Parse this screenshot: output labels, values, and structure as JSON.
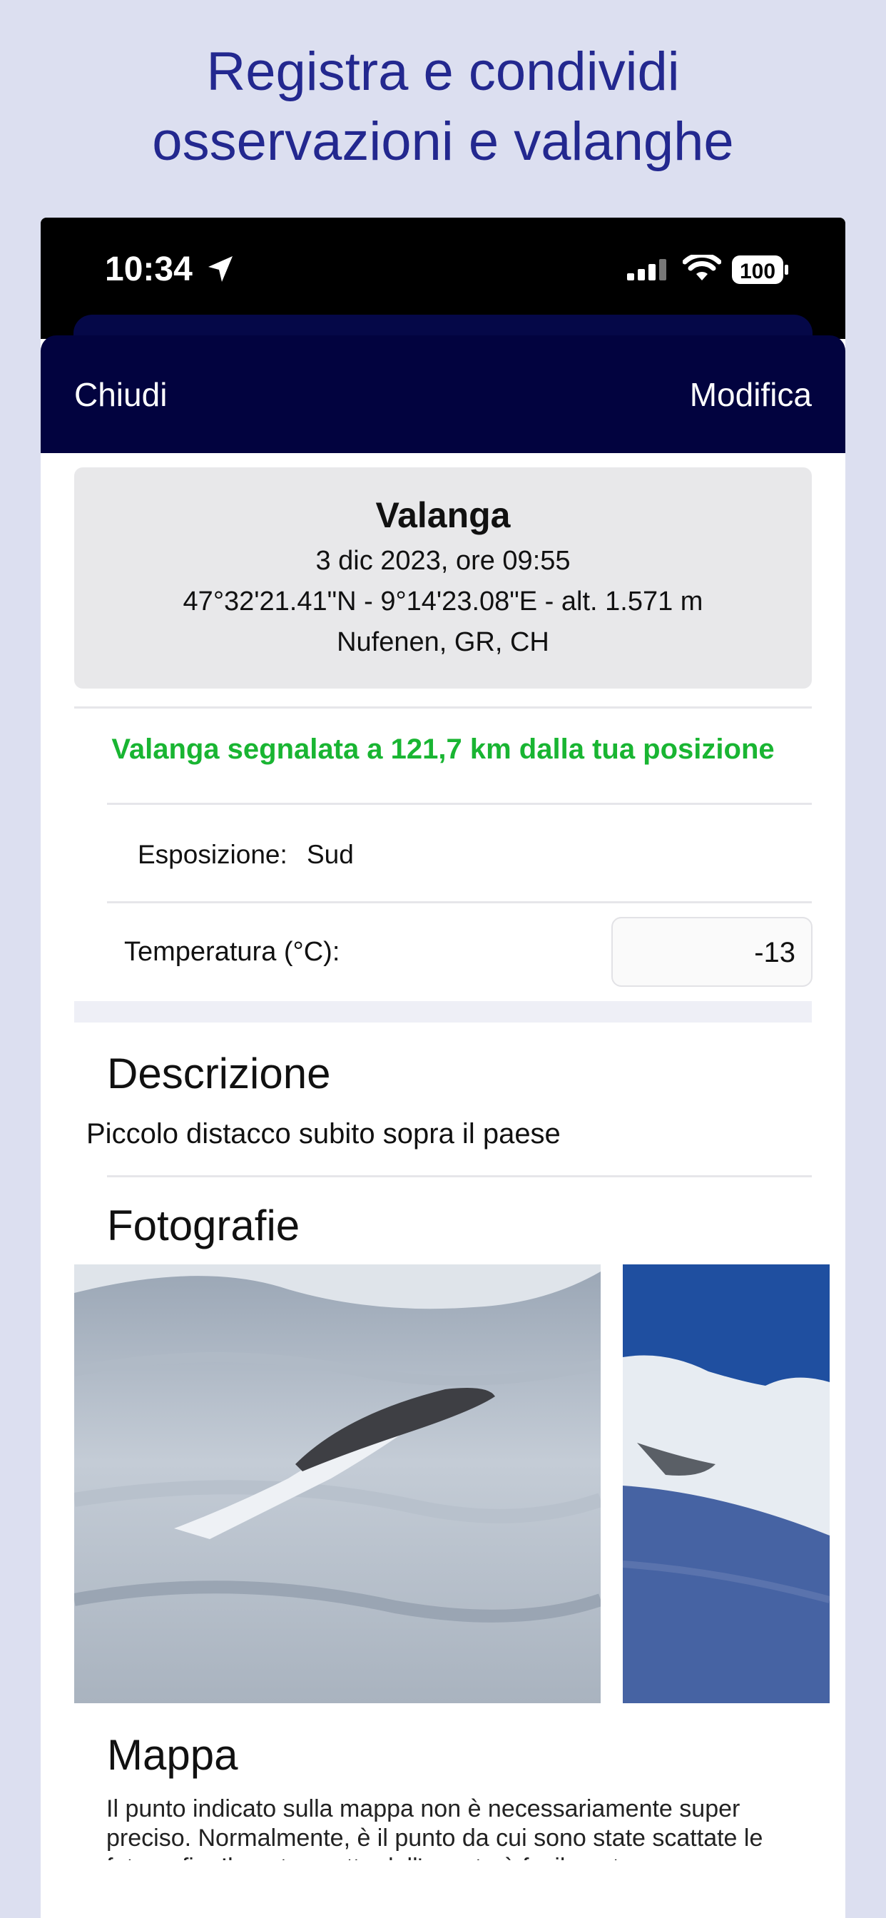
{
  "headline": {
    "line1": "Registra e condividi",
    "line2": "osservazioni e valanghe"
  },
  "status_bar": {
    "time": "10:34",
    "battery": "100",
    "icons": [
      "location-arrow-icon",
      "signal-icon",
      "wifi-icon",
      "battery-icon"
    ]
  },
  "nav": {
    "close_label": "Chiudi",
    "edit_label": "Modifica"
  },
  "summary": {
    "title": "Valanga",
    "date": "3 dic 2023, ore 09:55",
    "coords": "47°32'21.41\"N - 9°14'23.08\"E - alt. 1.571 m",
    "place": "Nufenen, GR, CH"
  },
  "distance_note": "Valanga segnalata a 121,7 km dalla tua posizione",
  "fields": {
    "exposure_label": "Esposizione:",
    "exposure_value": "Sud",
    "temperature_label": "Temperatura (°C):",
    "temperature_value": "-13"
  },
  "description": {
    "title": "Descrizione",
    "text": "Piccolo distacco subito sopra il paese"
  },
  "photos": {
    "title": "Fotografie",
    "items": [
      "avalanche-slope-photo",
      "mountain-ridge-photo"
    ]
  },
  "map": {
    "title": "Mappa",
    "text": "Il punto indicato sulla mappa non è necessariamente super preciso. Normalmente, è il punto da cui sono state scattate le fotografie. Il punto esatto dell'evento è facilmente"
  },
  "colors": {
    "page_bg": "#dcdff0",
    "headline": "#23288f",
    "navbar": "#02033f",
    "distance_green": "#19b532"
  }
}
